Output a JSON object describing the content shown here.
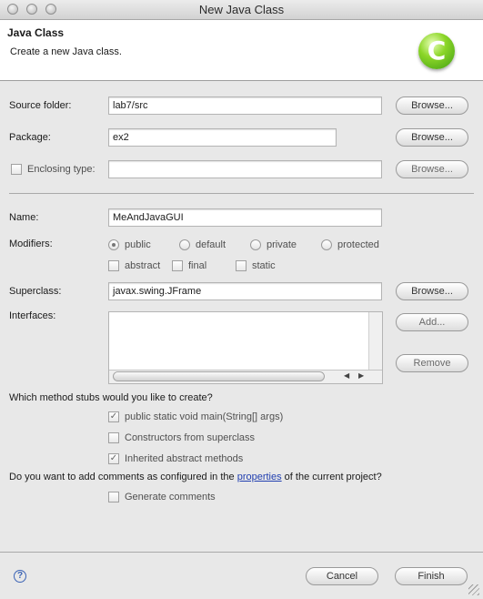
{
  "window": {
    "title": "New Java Class"
  },
  "header": {
    "title": "Java Class",
    "subtitle": "Create a new Java class.",
    "logo_letter": "C"
  },
  "source_folder": {
    "label": "Source folder:",
    "value": "lab7/src",
    "browse": "Browse..."
  },
  "package": {
    "label": "Package:",
    "value": "ex2",
    "browse": "Browse..."
  },
  "enclosing_type": {
    "label": "Enclosing type:",
    "value": "",
    "browse": "Browse...",
    "checked": false
  },
  "name": {
    "label": "Name:",
    "value": "MeAndJavaGUI"
  },
  "modifiers": {
    "label": "Modifiers:",
    "access": [
      "public",
      "default",
      "private",
      "protected"
    ],
    "selected": "public",
    "flags": [
      "abstract",
      "final",
      "static"
    ]
  },
  "superclass": {
    "label": "Superclass:",
    "value": "javax.swing.JFrame",
    "browse": "Browse..."
  },
  "interfaces": {
    "label": "Interfaces:",
    "add": "Add...",
    "remove": "Remove"
  },
  "stubs": {
    "question": "Which method stubs would you like to create?",
    "options": [
      {
        "label": "public static void main(String[] args)",
        "checked": true
      },
      {
        "label": "Constructors from superclass",
        "checked": false
      },
      {
        "label": "Inherited abstract methods",
        "checked": true
      }
    ]
  },
  "comments": {
    "question_prefix": "Do you want to add comments as configured in the ",
    "question_link": "properties",
    "question_suffix": " of the current project?",
    "option": "Generate comments",
    "checked": false
  },
  "footer": {
    "help": "?",
    "cancel": "Cancel",
    "finish": "Finish"
  },
  "colors": {
    "banner_bg": "#ffffff",
    "dialog_bg": "#e8e8e8",
    "logo_green": "#6cc21f",
    "link": "#2240b0"
  }
}
